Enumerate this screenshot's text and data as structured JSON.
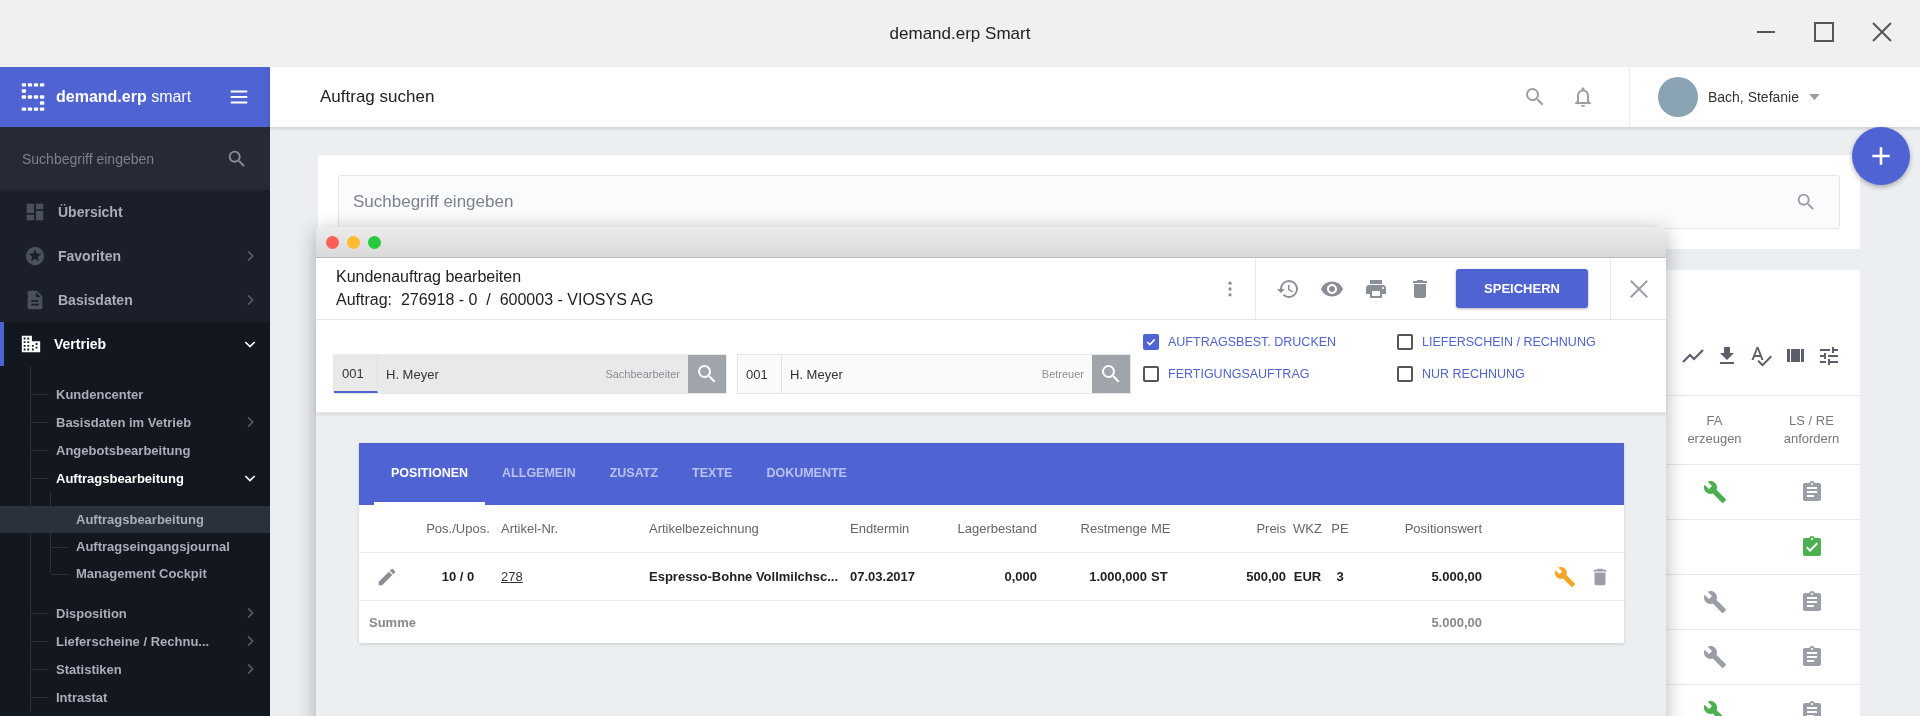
{
  "window": {
    "title": "demand.erp Smart"
  },
  "brand": {
    "name": "demand.erp",
    "suffix": "smart"
  },
  "sidebar": {
    "search": {
      "placeholder": "Suchbegriff eingeben"
    },
    "items": [
      {
        "label": "Übersicht",
        "expandable": false,
        "expanded": false
      },
      {
        "label": "Favoriten",
        "expandable": true,
        "expanded": false
      },
      {
        "label": "Basisdaten",
        "expandable": true,
        "expanded": false
      },
      {
        "label": "Vertrieb",
        "expandable": true,
        "expanded": true,
        "children": [
          {
            "label": "Kundencenter",
            "expandable": false,
            "expanded": false
          },
          {
            "label": "Basisdaten im Vetrieb",
            "expandable": true,
            "expanded": false
          },
          {
            "label": "Angebotsbearbeitung",
            "expandable": false,
            "expanded": false
          },
          {
            "label": "Auftragsbearbeitung",
            "expandable": true,
            "expanded": true,
            "children": [
              {
                "label": "Auftragsbearbeitung",
                "selected": true
              },
              {
                "label": "Auftragseingangsjournal",
                "selected": false
              },
              {
                "label": "Management Cockpit",
                "selected": false
              }
            ]
          },
          {
            "label": "Disposition",
            "expandable": true,
            "expanded": false
          },
          {
            "label": "Lieferscheine / Rechnu...",
            "expandable": true,
            "expanded": false
          },
          {
            "label": "Statistiken",
            "expandable": true,
            "expanded": false
          },
          {
            "label": "Intrastat",
            "expandable": false,
            "expanded": false
          }
        ]
      }
    ]
  },
  "header": {
    "title": "Auftrag suchen",
    "user": {
      "name": "Bach, Stefanie"
    }
  },
  "search": {
    "placeholder": "Suchbegriff eingeben"
  },
  "background_table": {
    "columns": [
      "FA erzeugen",
      "LS / RE anfordern"
    ],
    "rows": [
      {
        "fa_done": true,
        "ls_done": false
      },
      {
        "ls_done": true
      },
      {
        "fa_done": false,
        "ls_done": false
      },
      {
        "fa_done": false,
        "ls_done": false
      },
      {
        "fa_done": true,
        "ls_done": false
      }
    ]
  },
  "modal": {
    "title": "Kundenauftrag bearbeiten",
    "subtitle": "Auftrag:  276918 - 0  /  600003 - VIOSYS AG",
    "save_button": "SPEICHERN",
    "fields": [
      {
        "code": "001",
        "value": "H. Meyer",
        "caption": "Sachbearbeiter",
        "focused": true
      },
      {
        "code": "001",
        "value": "H. Meyer",
        "caption": "Betreuer",
        "focused": false
      }
    ],
    "options": [
      {
        "label": "AUFTRAGSBEST. DRUCKEN",
        "checked": true
      },
      {
        "label": "LIEFERSCHEIN / RECHNUNG",
        "checked": false
      },
      {
        "label": "FERTIGUNGSAUFTRAG",
        "checked": false
      },
      {
        "label": "NUR RECHNUNG",
        "checked": false
      }
    ],
    "tabs": [
      {
        "label": "POSITIONEN",
        "selected": true
      },
      {
        "label": "ALLGEMEIN",
        "selected": false
      },
      {
        "label": "ZUSATZ",
        "selected": false
      },
      {
        "label": "TEXTE",
        "selected": false
      },
      {
        "label": "DOKUMENTE",
        "selected": false
      }
    ],
    "table": {
      "columns": [
        "Pos./Upos.",
        "Artikel-Nr.",
        "Artikelbezeichnung",
        "Endtermin",
        "Lagerbestand",
        "Restmenge",
        "ME",
        "Preis",
        "WKZ",
        "PE",
        "Positionswert"
      ],
      "rows": [
        {
          "pos": "10 / 0",
          "artikel": "278",
          "bezeichnung": "Espresso-Bohne Vollmilchsc...",
          "endtermin": "07.03.2017",
          "lager": "0,000",
          "rest": "1.000,000",
          "me": "ST",
          "preis": "500,00",
          "wkz": "EUR",
          "pe": "3",
          "wert": "5.000,00"
        }
      ],
      "summary": {
        "label": "Summe",
        "total": "5.000,00"
      }
    }
  }
}
